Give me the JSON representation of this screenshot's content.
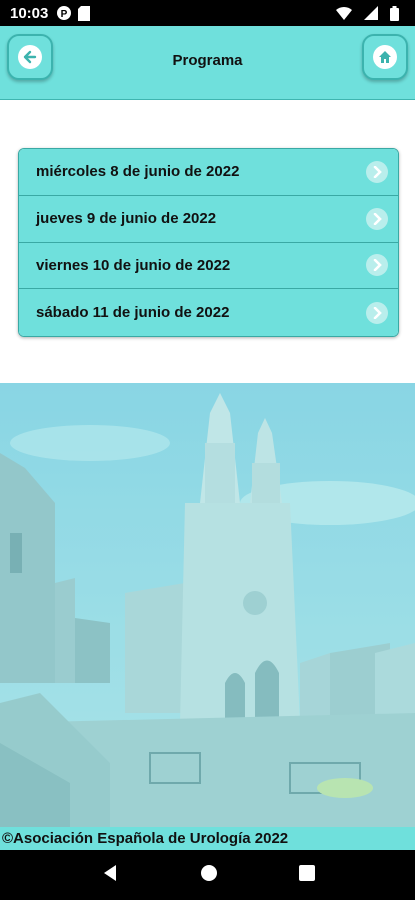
{
  "status_bar": {
    "time": "10:03"
  },
  "header": {
    "title": "Programa"
  },
  "days": [
    {
      "label": "miércoles 8 de junio de 2022"
    },
    {
      "label": "jueves 9 de junio de 2022"
    },
    {
      "label": "viernes 10 de junio de 2022"
    },
    {
      "label": "sábado 11 de junio de 2022"
    }
  ],
  "footer": {
    "text": "©Asociación Española de Urología 2022"
  },
  "icons": {
    "back": "arrow-left-icon",
    "home": "home-icon",
    "chevron": "chevron-right-icon"
  },
  "colors": {
    "accent": "#6fe0dc",
    "accent_border": "#3aa9a4"
  }
}
